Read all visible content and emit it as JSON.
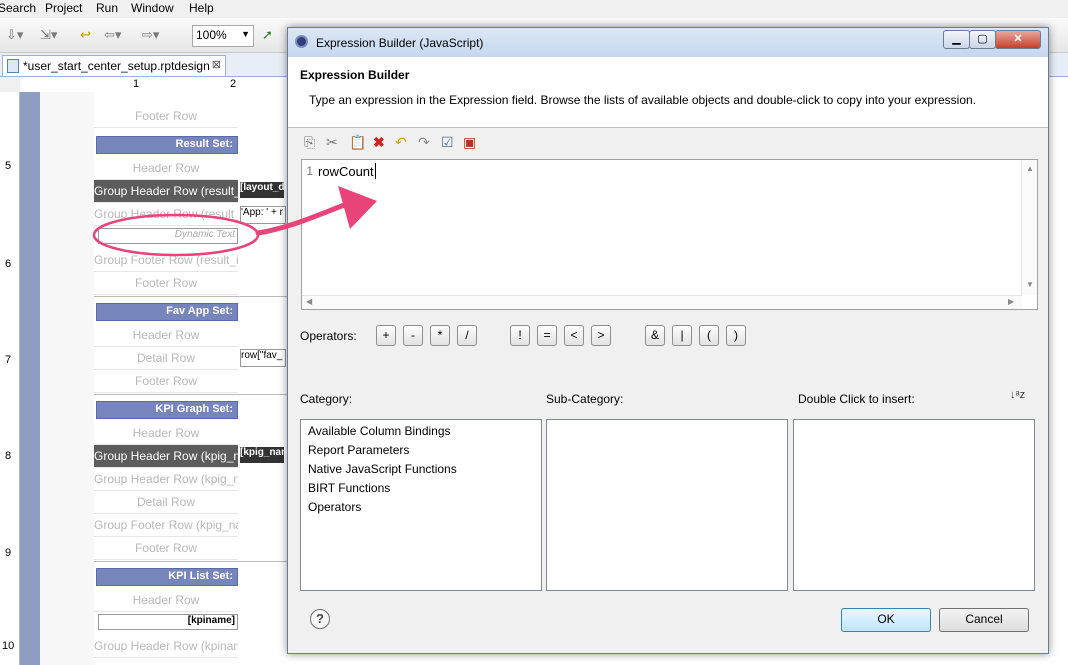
{
  "menubar": {
    "items": [
      "Search",
      "Project",
      "Run",
      "Window",
      "Help"
    ]
  },
  "toolbar": {
    "zoom": "100%"
  },
  "editor_tab": {
    "label": "*user_start_center_setup.rptdesign",
    "close": "⊠"
  },
  "ruler": {
    "h_marks": [
      "1",
      "2"
    ],
    "v_marks": [
      "5",
      "6",
      "7",
      "8",
      "9",
      "10"
    ]
  },
  "report": {
    "rows": [
      {
        "label": "Footer Row",
        "dark": false
      },
      {
        "label": "Header Row",
        "dark": false
      },
      {
        "label": "Group Header Row (result_id",
        "dark": true
      },
      {
        "label": "Group Header Row (result_id",
        "dark": false
      },
      {
        "label": "Group Footer Row (result_id",
        "dark": false
      },
      {
        "label": "Footer Row",
        "dark": false
      },
      {
        "label": "Header Row",
        "dark": false
      },
      {
        "label": "Detail Row",
        "dark": false
      },
      {
        "label": "Footer Row",
        "dark": false
      },
      {
        "label": "Header Row",
        "dark": false
      },
      {
        "label": "Group Header Row (kpig_nam",
        "dark": true
      },
      {
        "label": "Group Header Row (kpig_nam",
        "dark": false
      },
      {
        "label": "Detail Row",
        "dark": false
      },
      {
        "label": "Group Footer Row (kpig_nam",
        "dark": false
      },
      {
        "label": "Footer Row",
        "dark": false
      },
      {
        "label": "Header Row",
        "dark": false
      },
      {
        "label": "Group Header Row (kpiname",
        "dark": false
      }
    ],
    "section_headers": [
      "Result Set:",
      "Fav App Set:",
      "KPI Graph Set:",
      "KPI List Set:"
    ],
    "cells": [
      "[layout_d",
      "'App: ' + r",
      "row[\"fav_",
      "[kpig_nan",
      "[kpiname]"
    ],
    "dynamic_text": "Dynamic Text"
  },
  "dialog": {
    "title": "Expression Builder (JavaScript)",
    "heading": "Expression Builder",
    "description": "Type an expression in the Expression field. Browse the lists of available objects and double-click to copy into your expression.",
    "editor": {
      "line_number": "1",
      "code": "rowCount"
    },
    "operators_label": "Operators:",
    "operators": [
      "+",
      "-",
      "*",
      "/",
      "!",
      "=",
      "<",
      ">",
      "&",
      "|",
      "(",
      ")"
    ],
    "category_label": "Category:",
    "subcategory_label": "Sub-Category:",
    "insert_label": "Double Click to insert:",
    "categories": [
      "Available Column Bindings",
      "Report Parameters",
      "Native JavaScript Functions",
      "BIRT Functions",
      "Operators"
    ],
    "ok_label": "OK",
    "cancel_label": "Cancel",
    "help_symbol": "?"
  },
  "colors": {
    "accent": "#7785bd",
    "annotation": "#e8447a",
    "dialog_title_bg": "#c5d7ee"
  }
}
